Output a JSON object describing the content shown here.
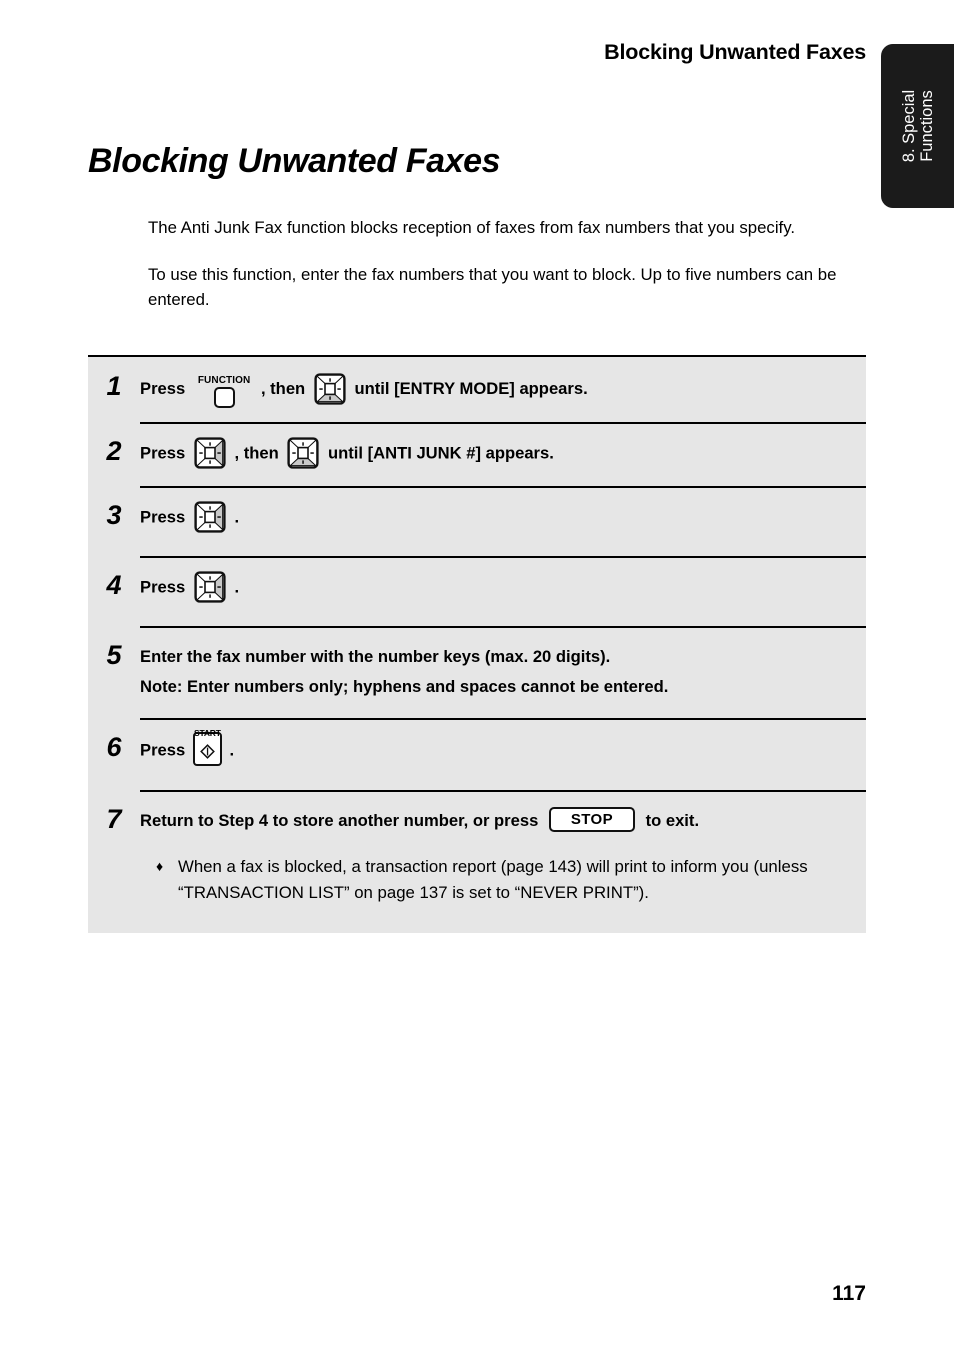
{
  "header": {
    "running_title": "Blocking Unwanted Faxes"
  },
  "side_tab": {
    "label": "8. Special\nFunctions"
  },
  "title": "Blocking Unwanted Faxes",
  "intro": {
    "paragraph1": "The Anti Junk Fax function blocks reception of faxes from fax numbers that you specify.",
    "paragraph2": "To use this function, enter the fax numbers that you want to block. Up to five numbers can be entered."
  },
  "steps": {
    "step1": {
      "number": "1",
      "press_label": "Press",
      "function_key_cap": "FUNCTION",
      "then_label": ", then",
      "tail": "until [ENTRY MODE] appears."
    },
    "step2": {
      "number": "2",
      "press_label": "Press",
      "then_label": ", then",
      "tail": "until [ANTI JUNK #] appears."
    },
    "step3": {
      "number": "3",
      "press_label": "Press",
      "tail": "."
    },
    "step4": {
      "number": "4",
      "press_label": "Press",
      "tail": "."
    },
    "step5": {
      "number": "5",
      "line1": "Enter the fax number with the number keys (max. 20 digits).",
      "line2": "Note: Enter numbers only; hyphens and spaces cannot be entered."
    },
    "step6": {
      "number": "6",
      "press_label": "Press",
      "start_key_cap": "START",
      "tail": "."
    },
    "step7": {
      "number": "7",
      "lead": "Return to Step 4 to store another number, or press",
      "stop_key_label": "STOP",
      "tail": "to exit.",
      "note_bullet": "♦",
      "note_text": "When a fax is blocked, a transaction report (page 143) will print to inform you (unless “TRANSACTION LIST” on page 137 is set to “NEVER PRINT”)."
    }
  },
  "footer": {
    "page_number": "117"
  },
  "colors": {
    "panel_background": "#e6e6e6",
    "tab_background": "#1b1b1b",
    "key_shade": "#c9c9c9",
    "text": "#000000"
  }
}
